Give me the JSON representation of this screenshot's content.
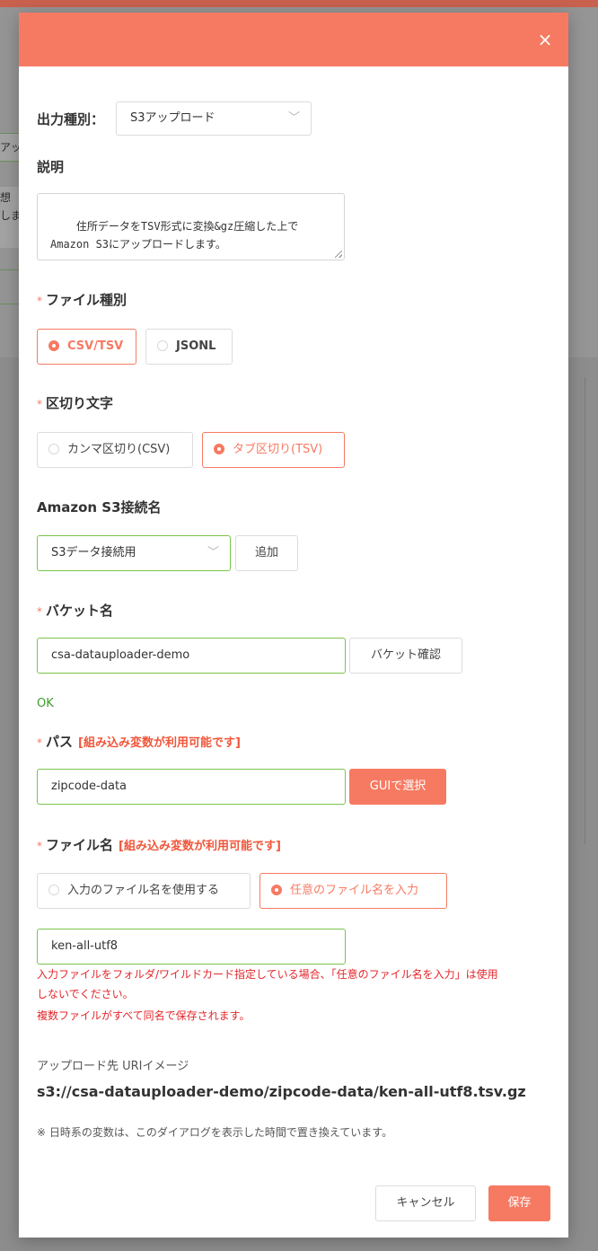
{
  "modal": {
    "close_icon": "×",
    "output_type": {
      "label": "出力種別：",
      "value": "S3アップロード"
    },
    "description": {
      "label": "説明",
      "value": "住所データをTSV形式に変換&gz圧縮した上で\nAmazon S3にアップロードします。"
    },
    "file_type": {
      "label": "ファイル種別",
      "options": [
        {
          "label": "CSV/TSV",
          "selected": true
        },
        {
          "label": "JSONL",
          "selected": false
        }
      ]
    },
    "delimiter": {
      "label": "区切り文字",
      "options": [
        {
          "label": "カンマ区切り(CSV)",
          "selected": false
        },
        {
          "label": "タブ区切り(TSV)",
          "selected": true
        }
      ]
    },
    "s3_connection": {
      "label": "Amazon S3接続名",
      "value": "S3データ接続用",
      "add_button": "追加"
    },
    "bucket": {
      "label": "バケット名",
      "value": "csa-datauploader-demo",
      "check_button": "バケット確認",
      "status": "OK"
    },
    "path": {
      "label": "パス",
      "hint": "[組み込み変数が利用可能です]",
      "value": "zipcode-data",
      "gui_button": "GUIで選択"
    },
    "file_name": {
      "label": "ファイル名",
      "hint": "[組み込み変数が利用可能です]",
      "options": [
        {
          "label": "入力のファイル名を使用する",
          "selected": false
        },
        {
          "label": "任意のファイル名を入力",
          "selected": true
        }
      ],
      "value": "ken-all-utf8",
      "warning_line1": "入力ファイルをフォルダ/ワイルドカード指定している場合、「任意のファイル名を入力」は使用",
      "warning_line2": "しないでください。",
      "warning_line3": "複数ファイルがすべて同名で保存されます。"
    },
    "uri_preview": {
      "label": "アップロード先 URIイメージ",
      "value": "s3://csa-datauploader-demo/zipcode-data/ken-all-utf8.tsv.gz",
      "note": "※ 日時系の変数は、このダイアログを表示した時間で置き換えています。"
    },
    "footer": {
      "cancel": "キャンセル",
      "save": "保存"
    }
  },
  "background": {
    "fragment1": "アッ",
    "fragment2a": "想",
    "fragment2b": "しま"
  },
  "colors": {
    "accent": "#f67a62",
    "valid": "#79c44b",
    "ok": "#3c9a2a",
    "error": "#e4262b"
  }
}
